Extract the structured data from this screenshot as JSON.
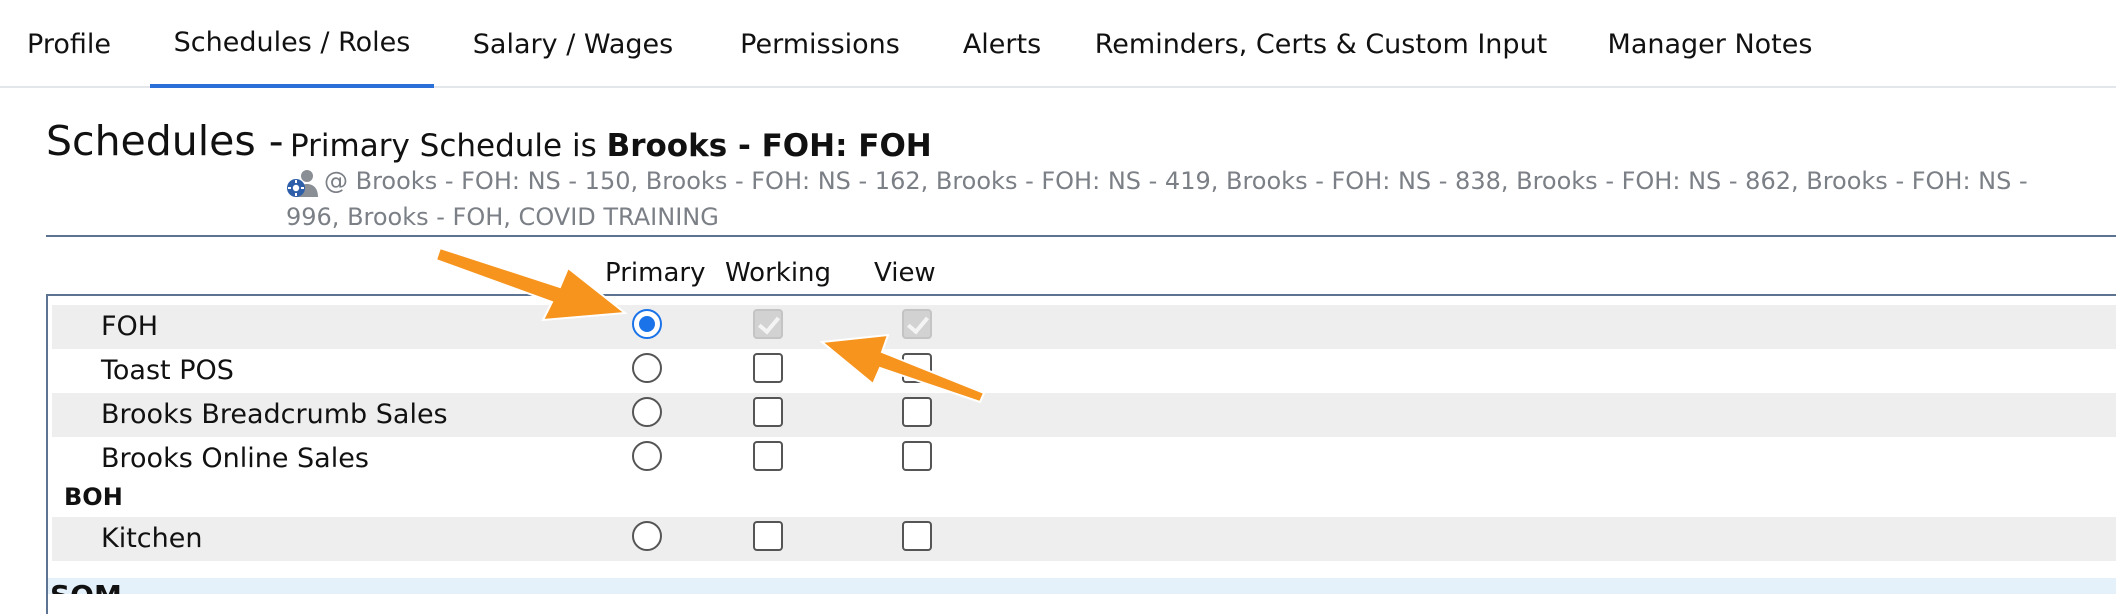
{
  "tabs": [
    {
      "label": "Profile"
    },
    {
      "label": "Schedules / Roles"
    },
    {
      "label": "Salary / Wages"
    },
    {
      "label": "Permissions"
    },
    {
      "label": "Alerts"
    },
    {
      "label": "Reminders, Certs & Custom Input"
    },
    {
      "label": "Manager Notes"
    }
  ],
  "active_tab": "Schedules / Roles",
  "schedules": {
    "title": "Schedules -",
    "primary_prefix": "Primary Schedule is",
    "primary_value": "Brooks - FOH: FOH",
    "also_scheduled": "@ Brooks - FOH: NS - 150, Brooks - FOH: NS - 162, Brooks - FOH: NS - 419, Brooks - FOH: NS - 838, Brooks - FOH: NS - 862, Brooks - FOH: NS - 996, Brooks - FOH, COVID TRAINING",
    "people_icon": "people-icon"
  },
  "columns": {
    "primary": "Primary",
    "working": "Working",
    "view": "View"
  },
  "rows": [
    {
      "label": "FOH",
      "primary": true,
      "working": "checked-disabled",
      "view": "checked-disabled"
    },
    {
      "label": "Toast POS",
      "primary": false,
      "working": "unchecked",
      "view": "unchecked"
    },
    {
      "label": "Brooks Breadcrumb Sales",
      "primary": false,
      "working": "unchecked",
      "view": "unchecked"
    },
    {
      "label": "Brooks Online Sales",
      "primary": false,
      "working": "unchecked",
      "view": "unchecked"
    },
    {
      "label": "Kitchen",
      "primary": false,
      "working": "unchecked",
      "view": "unchecked"
    }
  ],
  "groups": {
    "boh": "BOH",
    "next": "SOM"
  },
  "colors": {
    "accent": "#2b6fd8",
    "radio": "#1a73e8",
    "annotation_arrow": "#f7941d",
    "divider": "#5c7392"
  }
}
